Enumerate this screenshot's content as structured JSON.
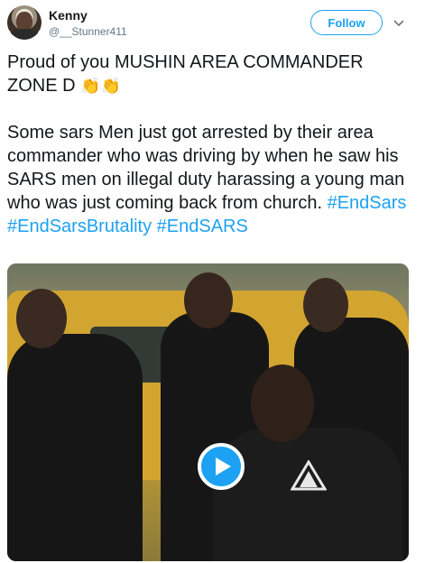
{
  "user": {
    "name": "Kenny",
    "handle": "@__Stunner411"
  },
  "actions": {
    "follow_label": "Follow",
    "caret_icon": "chevron-down-icon"
  },
  "tweet": {
    "para1_text": "Proud of you MUSHIN AREA COMMANDER ZONE D ",
    "para1_emoji": "👏👏",
    "para2_text": "Some sars Men just got arrested by their area commander who was driving by when he saw his SARS men on illegal duty harassing a young man who was just coming back from church. ",
    "hashtags": [
      "#EndSars",
      "#EndSarsBrutality",
      "#EndSARS"
    ]
  },
  "media": {
    "type": "video",
    "play_icon": "play-icon"
  },
  "colors": {
    "accent": "#1da1f2",
    "text": "#14171a",
    "muted": "#657786"
  }
}
